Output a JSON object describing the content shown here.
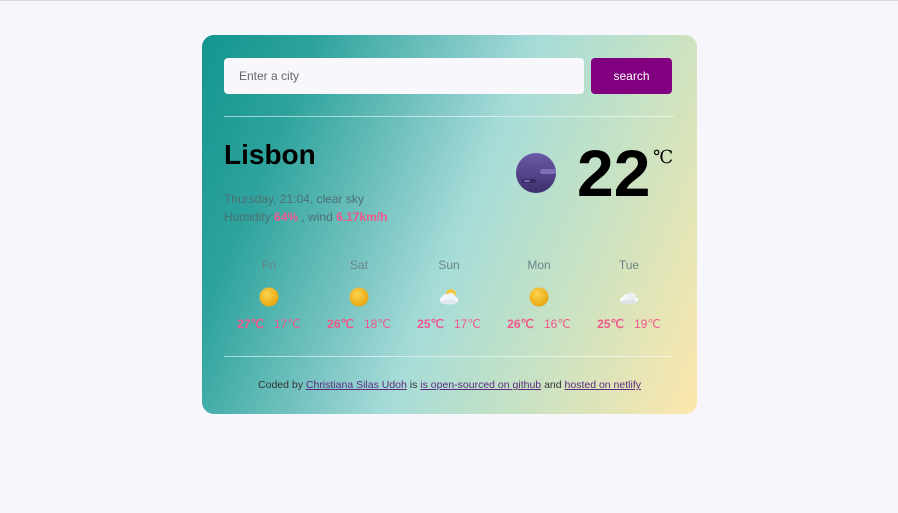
{
  "search": {
    "placeholder": "Enter a city",
    "button_label": "search"
  },
  "current": {
    "city": "Lisbon",
    "datetime": "Thursday, 21:04",
    "description": "clear sky",
    "humidity_label": "Humidity:",
    "humidity_value": "64%",
    "wind_label": ", wind",
    "wind_value": "6.17km/h",
    "temperature": "22",
    "unit": "℃",
    "icon": "moon-clear-night-icon"
  },
  "forecast": [
    {
      "day": "Fri",
      "icon": "sun-icon",
      "max": "27℃",
      "min": "17℃"
    },
    {
      "day": "Sat",
      "icon": "sun-icon",
      "max": "26℃",
      "min": "18℃"
    },
    {
      "day": "Sun",
      "icon": "partly-cloudy-icon",
      "max": "25℃",
      "min": "17℃"
    },
    {
      "day": "Mon",
      "icon": "sun-icon",
      "max": "26℃",
      "min": "16℃"
    },
    {
      "day": "Tue",
      "icon": "cloud-icon",
      "max": "25℃",
      "min": "19℃"
    }
  ],
  "footer": {
    "prefix": "Coded by",
    "author": "Christiana Silas Udoh",
    "is": "is",
    "github_link": "is open-sourced on github",
    "and": "and",
    "netlify_link": "hosted on netlify"
  },
  "colors": {
    "accent": "#800080",
    "highlight": "#f0588c"
  }
}
